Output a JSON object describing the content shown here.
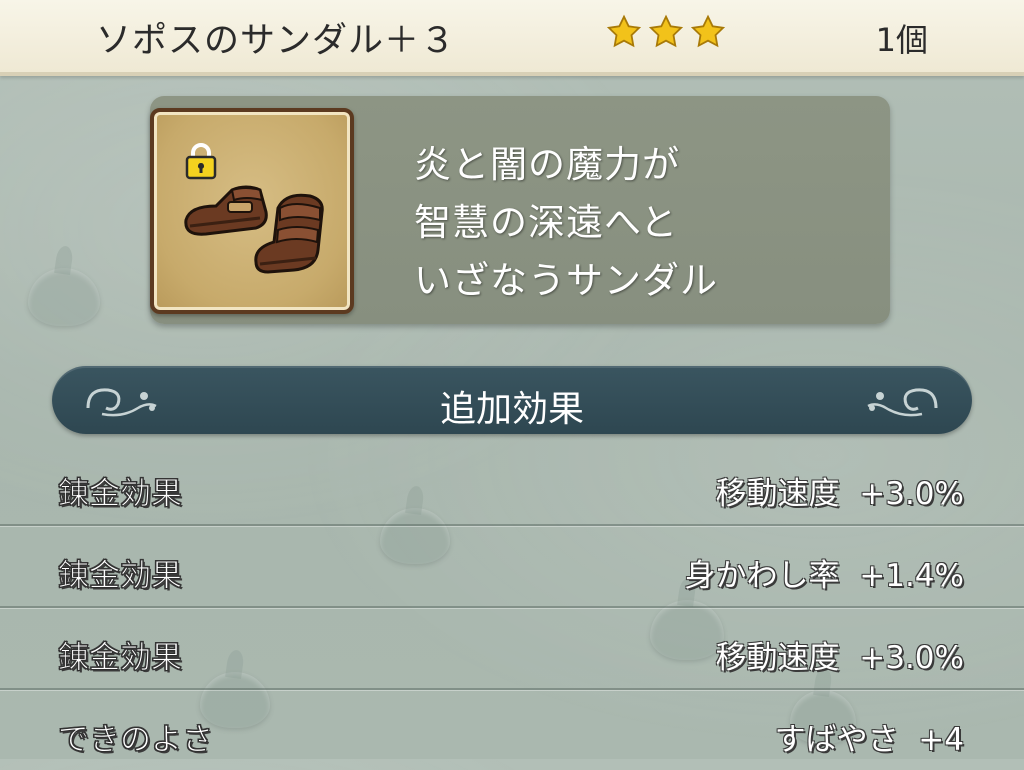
{
  "header": {
    "item_name": "ソポスのサンダル＋３",
    "rarity_stars": 3,
    "count": "1個"
  },
  "item": {
    "icon": "leather-sandals-icon",
    "locked": true,
    "description_lines": [
      "炎と闇の魔力が",
      "智慧の深遠へと",
      "いざなうサンダル"
    ]
  },
  "section": {
    "title": "追加効果"
  },
  "effects": [
    {
      "label": "錬金効果",
      "value": "移動速度  +3.0%"
    },
    {
      "label": "錬金効果",
      "value": "身かわし率  +1.4%"
    },
    {
      "label": "錬金効果",
      "value": "移動速度  +3.0%"
    },
    {
      "label": "できのよさ",
      "value": "すばやさ  +4"
    }
  ],
  "colors": {
    "star": "#f2c21a",
    "section_bar": "#2e4751",
    "panel": "#878f7f",
    "header_bg": "#f3eedc"
  }
}
